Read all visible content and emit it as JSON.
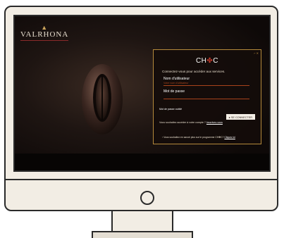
{
  "brand": {
    "name": "VALRHONA"
  },
  "login": {
    "logo_left": "CH",
    "logo_mid": "✤",
    "logo_right": "C",
    "close_label": "⌐ ✕",
    "intro": "Connectez-vous pour accéder aux services.",
    "username_label": "Nom d'utilisateur",
    "username_placeholder": "Votre nom d'utilisateur",
    "password_label": "Mot de passe",
    "forgot": "Mot de passe oublié",
    "connect_button": "▸ SE CONNECTER",
    "no_account": "Vous souhaitez accéder à votre compte ?",
    "no_account_link": "Inscrivez-vous",
    "footer_note": "› Vous souhaitez en savoir plus sur le programme CH✤C?",
    "footer_link": "Cliquez ici"
  },
  "colors": {
    "accent": "#b58a3c",
    "brand_red": "#a8431b",
    "panel_bg": "#140c0a"
  }
}
